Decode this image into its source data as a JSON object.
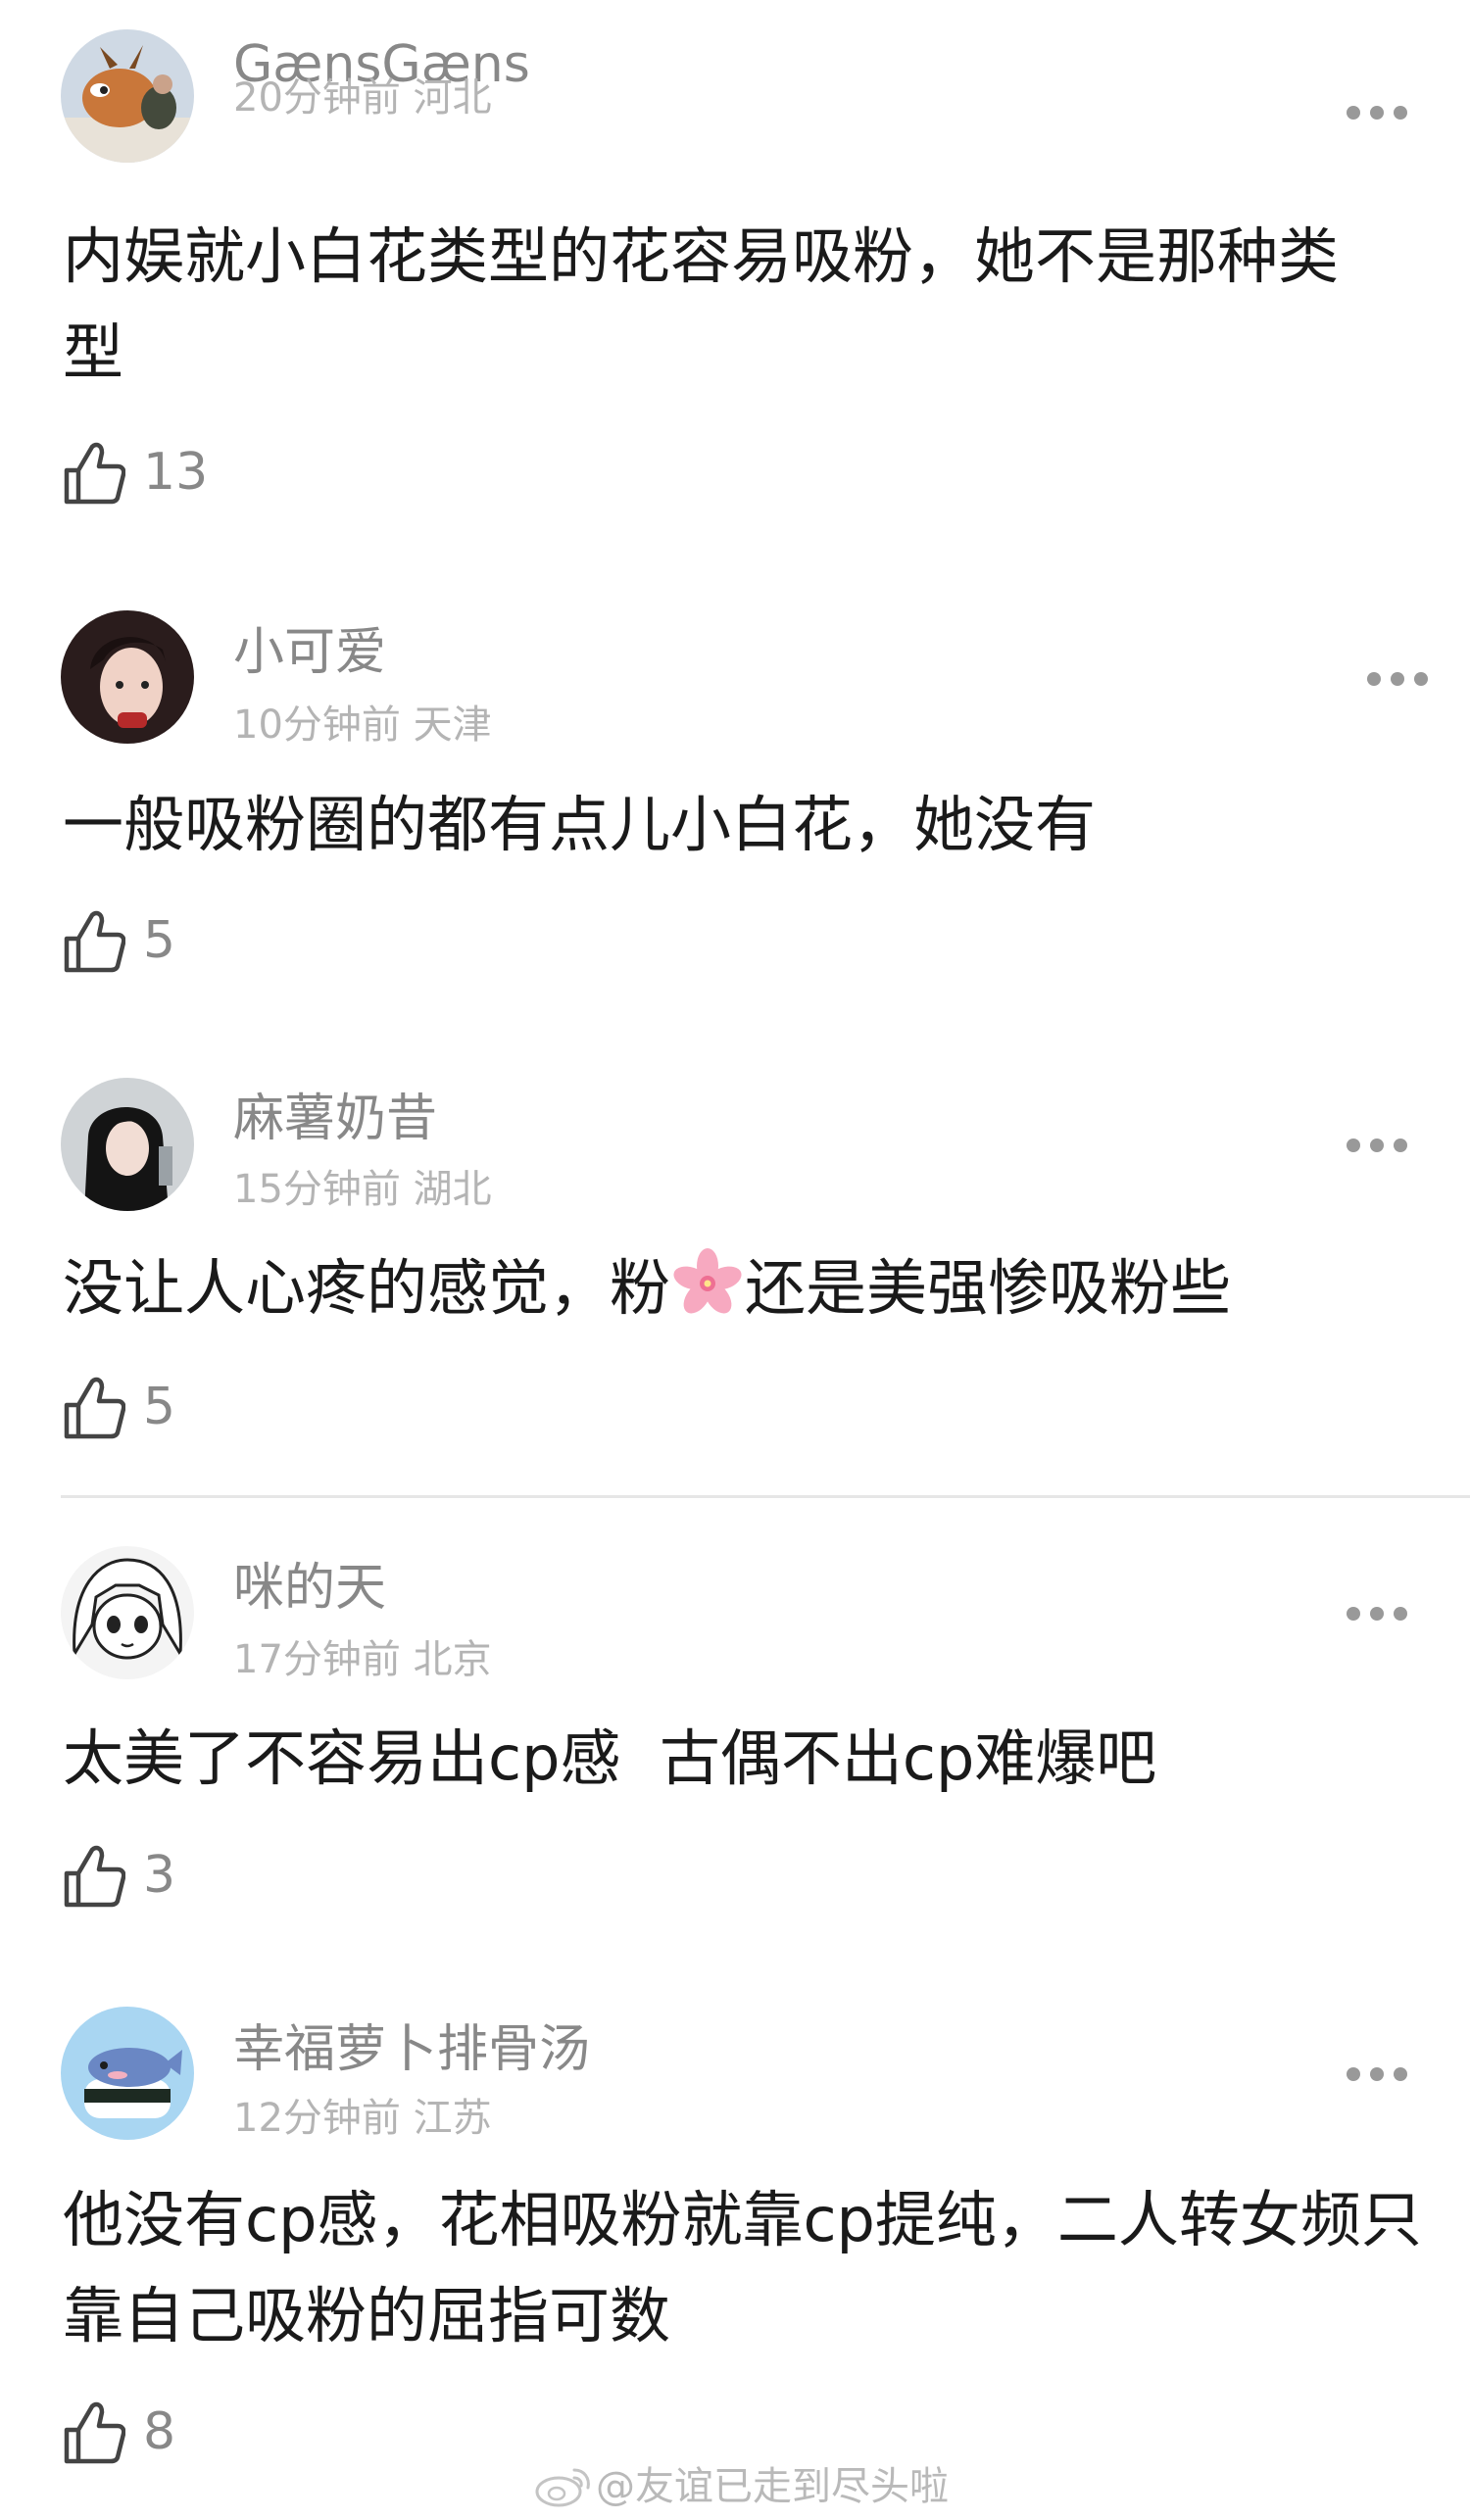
{
  "comments": [
    {
      "username": "GænsGæns",
      "time": "20分钟前",
      "location": "河北",
      "text": "内娱就小白花类型的花容易吸粉，她不是那种类型",
      "likes": "13",
      "avatar_icon": "cartoon-deer-avatar"
    },
    {
      "username": "小可爱",
      "time": "10分钟前",
      "location": "天津",
      "text": "一般吸粉圈的都有点儿小白花，她没有",
      "likes": "5",
      "avatar_icon": "portrait-photo-avatar"
    },
    {
      "username": "麻薯奶昔",
      "time": "15分钟前",
      "location": "湖北",
      "text_before": "没让人心疼的感觉，粉",
      "text_emoji": "cherry-blossom-icon",
      "text_after": "还是美强惨吸粉些",
      "likes": "5",
      "avatar_icon": "portrait-photo-avatar"
    },
    {
      "username": "咪的天",
      "time": "17分钟前",
      "location": "北京",
      "text": "太美了不容易出cp感  古偶不出cp难爆吧",
      "likes": "3",
      "avatar_icon": "anime-girl-avatar"
    },
    {
      "username": "幸福萝卜排骨汤",
      "time": "12分钟前",
      "location": "江苏",
      "text": "他没有cp感，花相吸粉就靠cp提纯，二人转女频只靠自己吸粉的屈指可数",
      "likes": "8",
      "avatar_icon": "whale-sushi-avatar"
    }
  ],
  "watermark": {
    "text": "@友谊已走到尽头啦",
    "icon": "weibo-icon"
  },
  "colors": {
    "text_primary": "#1a1a1a",
    "text_secondary": "#888888",
    "text_meta": "#b4b4b4",
    "divider": "#e6e6e6"
  }
}
